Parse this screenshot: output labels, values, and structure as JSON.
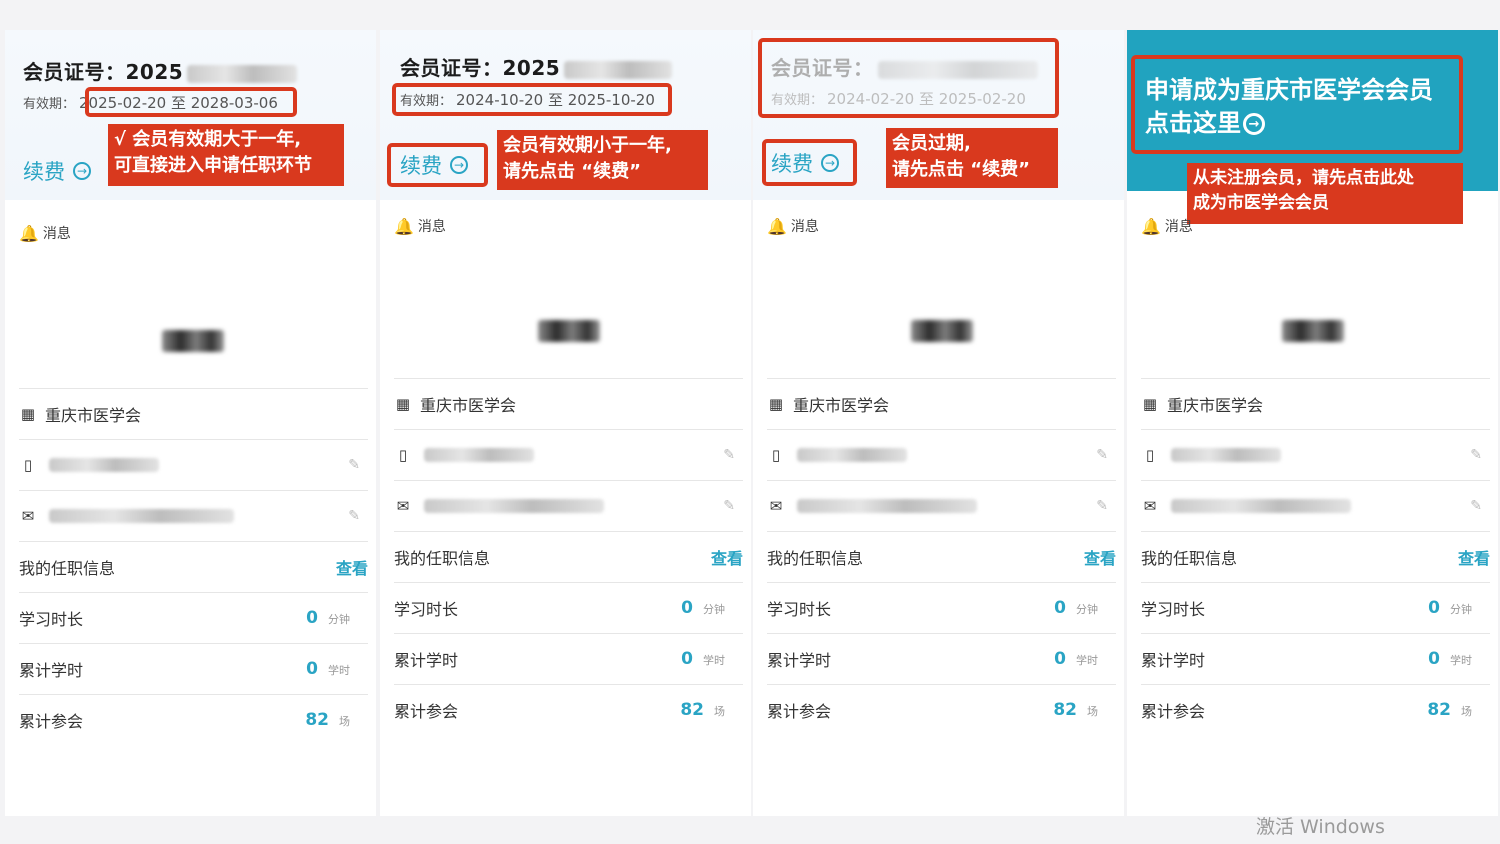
{
  "panels": [
    {
      "member_label": "会员证号：2025",
      "validity_label": "有效期：",
      "validity_dates": "2025-02-20 至 2028-03-06",
      "renew_label": "续费",
      "callout": [
        "√ 会员有效期大于一年,",
        "可直接进入申请任职环节"
      ],
      "message_label": "消息",
      "org_name": "重庆市医学会",
      "duty_label": "我的任职信息",
      "view_label": "查看",
      "stats": [
        {
          "label": "学习时长",
          "value": "0",
          "unit": "分钟"
        },
        {
          "label": "累计学时",
          "value": "0",
          "unit": "学时"
        },
        {
          "label": "累计参会",
          "value": "82",
          "unit": "场"
        }
      ]
    },
    {
      "member_label": "会员证号：2025",
      "validity_label": "有效期：",
      "validity_dates": "2024-10-20 至 2025-10-20",
      "renew_label": "续费",
      "callout": [
        "会员有效期小于一年,",
        "请先点击 “续费”"
      ],
      "message_label": "消息",
      "org_name": "重庆市医学会",
      "duty_label": "我的任职信息",
      "view_label": "查看",
      "stats": [
        {
          "label": "学习时长",
          "value": "0",
          "unit": "分钟"
        },
        {
          "label": "累计学时",
          "value": "0",
          "unit": "学时"
        },
        {
          "label": "累计参会",
          "value": "82",
          "unit": "场"
        }
      ]
    },
    {
      "member_label": "会员证号：",
      "validity_label": "有效期：",
      "validity_dates": "2024-02-20 至 2025-02-20",
      "renew_label": "续费",
      "callout": [
        "会员过期,",
        "请先点击 “续费”"
      ],
      "message_label": "消息",
      "org_name": "重庆市医学会",
      "duty_label": "我的任职信息",
      "view_label": "查看",
      "stats": [
        {
          "label": "学习时长",
          "value": "0",
          "unit": "分钟"
        },
        {
          "label": "累计学时",
          "value": "0",
          "unit": "学时"
        },
        {
          "label": "累计参会",
          "value": "82",
          "unit": "场"
        }
      ]
    },
    {
      "apply_text": [
        "申请成为重庆市医学会会员",
        "点击这里"
      ],
      "callout": [
        "从未注册会员，请先点击此处",
        "成为市医学会会员"
      ],
      "message_label": "消息",
      "org_name": "重庆市医学会",
      "duty_label": "我的任职信息",
      "view_label": "查看",
      "stats": [
        {
          "label": "学习时长",
          "value": "0",
          "unit": "分钟"
        },
        {
          "label": "累计学时",
          "value": "0",
          "unit": "学时"
        },
        {
          "label": "累计参会",
          "value": "82",
          "unit": "场"
        }
      ]
    }
  ],
  "watermark": "激活 Windows",
  "colors": {
    "accent": "#2aa4c4",
    "annotation_red": "#d9391e",
    "header_teal": "#21a3bf"
  }
}
